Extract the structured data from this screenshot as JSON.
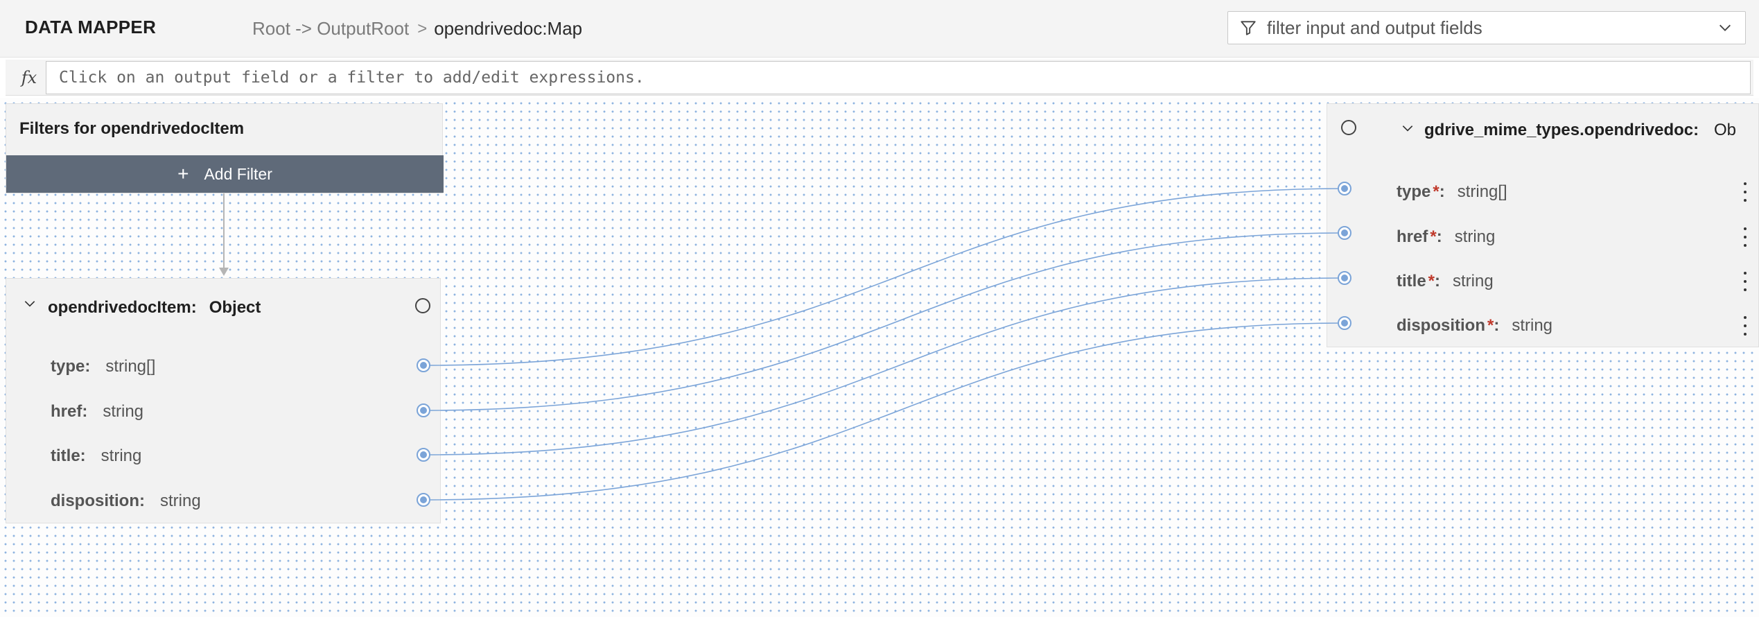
{
  "header": {
    "title": "DATA MAPPER",
    "breadcrumb": {
      "path": "Root -> OutputRoot",
      "separator": ">",
      "current": "opendrivedoc:Map"
    },
    "filter": {
      "placeholder": "filter input and output fields",
      "icon": "filter-icon"
    }
  },
  "expression_bar": {
    "fx_label": "fx",
    "placeholder": "Click on an output field or a filter to add/edit expressions."
  },
  "filters_panel": {
    "title": "Filters for opendrivedocItem",
    "add_filter_label": "Add Filter",
    "add_icon": "+"
  },
  "input_node": {
    "name": "opendrivedocItem:",
    "type": "Object",
    "fields": [
      {
        "name": "type:",
        "type": "string[]"
      },
      {
        "name": "href:",
        "type": "string"
      },
      {
        "name": "title:",
        "type": "string"
      },
      {
        "name": "disposition:",
        "type": "string"
      }
    ]
  },
  "output_node": {
    "name": "gdrive_mime_types.opendrivedoc:",
    "type": "Ob",
    "fields": [
      {
        "name": "type",
        "required": "*",
        "colon": ":",
        "type": "string[]"
      },
      {
        "name": "href",
        "required": "*",
        "colon": ":",
        "type": "string"
      },
      {
        "name": "title",
        "required": "*",
        "colon": ":",
        "type": "string"
      },
      {
        "name": "disposition",
        "required": "*",
        "colon": ":",
        "type": "string"
      }
    ]
  },
  "colors": {
    "accent_button": "#5f6a79",
    "link_line": "#7ba4d8",
    "required_mark": "#c0392b",
    "canvas_dot": "#8fb4e0"
  }
}
